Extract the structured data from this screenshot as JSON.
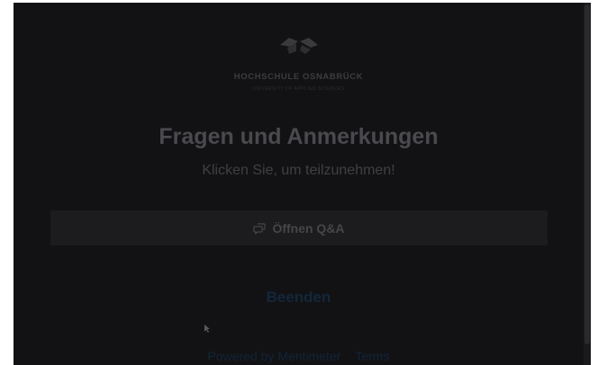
{
  "logo": {
    "name": "HOCHSCHULE OSNABRÜCK",
    "subtitle": "UNIVERSITY OF APPLIED SCIENCES"
  },
  "slide": {
    "title": "Fragen und Anmerkungen",
    "subtitle": "Klicken Sie, um teilzunehmen!"
  },
  "actions": {
    "open_qa_label": "Öffnen Q&A",
    "open_qa_icon": "speech-bubbles-icon",
    "end_label": "Beenden"
  },
  "footer": {
    "powered_by": "Powered by Mentimeter",
    "terms": "Terms"
  },
  "colors": {
    "background": "#121214",
    "button_background": "#1c1b1e",
    "link": "#12273c"
  }
}
